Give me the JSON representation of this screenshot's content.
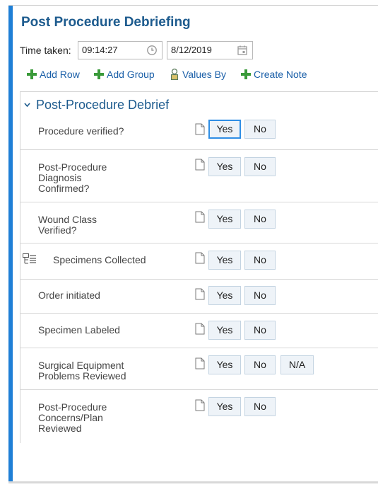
{
  "title": "Post Procedure Debriefing",
  "time_taken": {
    "label": "Time taken:",
    "time_value": "09:14:27",
    "date_value": "8/12/2019"
  },
  "toolbar": {
    "add_row": "Add Row",
    "add_group": "Add Group",
    "values_by": "Values By",
    "create_note": "Create Note"
  },
  "section": {
    "title": "Post-Procedure Debrief",
    "rows": [
      {
        "label": "Procedure verified?",
        "yes": "Yes",
        "no": "No"
      },
      {
        "label": "Post-Procedure Diagnosis Confirmed?",
        "yes": "Yes",
        "no": "No"
      },
      {
        "label": "Wound Class Verified?",
        "yes": "Yes",
        "no": "No"
      },
      {
        "label": "Specimens Collected",
        "yes": "Yes",
        "no": "No"
      },
      {
        "label": "Order initiated",
        "yes": "Yes",
        "no": "No"
      },
      {
        "label": "Specimen Labeled",
        "yes": "Yes",
        "no": "No"
      },
      {
        "label": "Surgical Equipment Problems Reviewed",
        "yes": "Yes",
        "no": "No",
        "na": "N/A"
      },
      {
        "label": "Post-Procedure Concerns/Plan Reviewed",
        "yes": "Yes",
        "no": "No"
      }
    ]
  },
  "colors": {
    "accent_bar": "#1f7fd6",
    "title": "#1d5b8e",
    "link": "#1a5fa8",
    "add_icon": "#3a9a3a"
  }
}
